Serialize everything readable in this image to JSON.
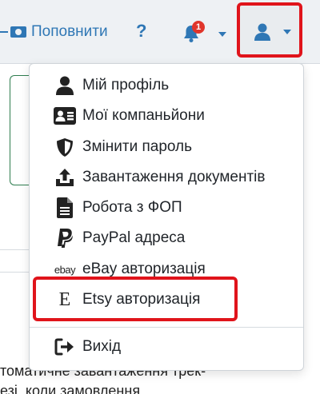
{
  "navbar": {
    "topup_label": "Поповнити",
    "help_label": "?",
    "notifications_count": "1"
  },
  "background": {
    "line1": "томатичне завантаження трек-",
    "line2": "езі, коли замовлення"
  },
  "menu": {
    "items": [
      {
        "label": "Мій профіль",
        "icon": "user-icon"
      },
      {
        "label": "Мої компаньйони",
        "icon": "id-card-icon"
      },
      {
        "label": "Змінити пароль",
        "icon": "shield-icon"
      },
      {
        "label": "Завантаження документів",
        "icon": "upload-icon"
      },
      {
        "label": "Робота з ФОП",
        "icon": "document-icon"
      },
      {
        "label": "PayPal адреса",
        "icon": "paypal-icon"
      },
      {
        "label": "eBay авторизація",
        "icon": "ebay-logo-icon",
        "icon_text": "ebay"
      },
      {
        "label": "Etsy авторизація",
        "icon": "etsy-logo-icon",
        "icon_text": "E"
      },
      {
        "label": "Вихід",
        "icon": "sign-out-icon"
      }
    ]
  },
  "colors": {
    "accent": "#2f77b5",
    "highlight": "#e0141b",
    "badge": "#e0352b"
  }
}
